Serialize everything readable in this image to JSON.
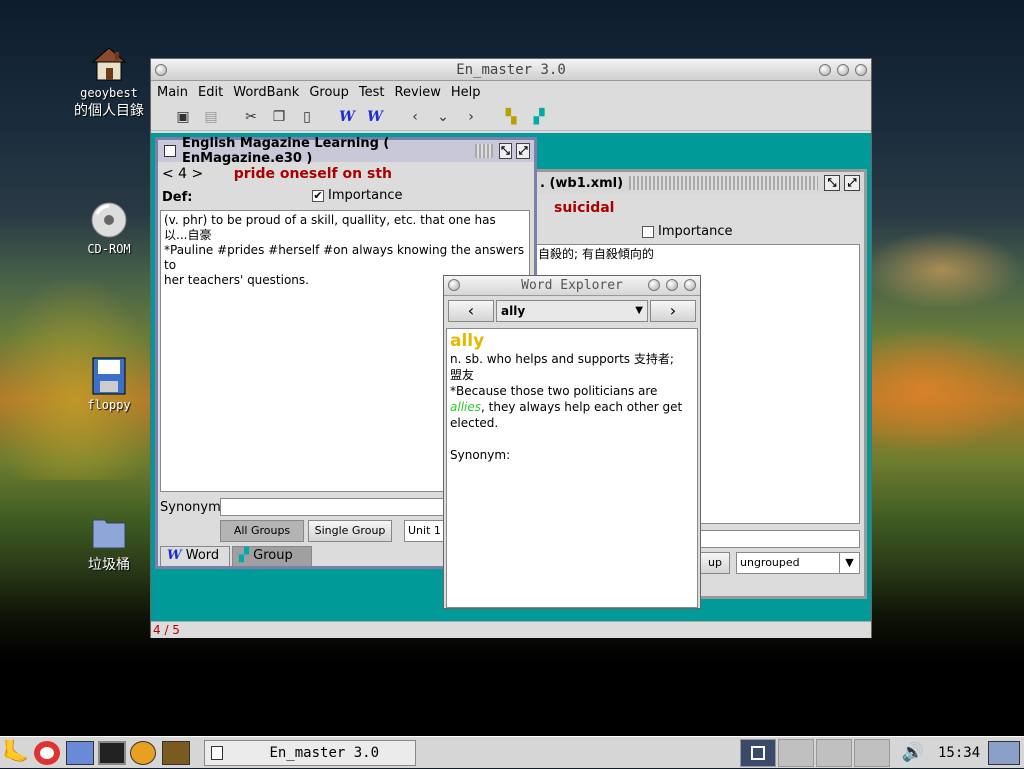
{
  "desktop": {
    "icons": [
      {
        "label_line1": "geoybest",
        "label_line2": "的個人目錄",
        "name": "home-icon"
      },
      {
        "label_line1": "CD-ROM",
        "name": "cdrom-icon"
      },
      {
        "label_line1": "floppy",
        "name": "floppy-icon"
      },
      {
        "label_line1": "垃圾桶",
        "name": "trash-icon"
      }
    ]
  },
  "app": {
    "title": "En_master 3.0",
    "menu": [
      "Main",
      "Edit",
      "WordBank",
      "Group",
      "Test",
      "Review",
      "Help"
    ],
    "status": "4 / 5"
  },
  "frame1": {
    "title": "English Magazine Learning ( EnMagazine.e30 )",
    "nav_prefix": "< 4 >",
    "headword": "pride oneself on sth",
    "def_label": "Def:",
    "importance_label": "Importance",
    "importance_checked": "✔",
    "definition_line1": "(v. phr) to be proud of a skill, quallity, etc. that one has",
    "definition_line2": "以...自豪",
    "definition_line3": "*Pauline #prides #herself #on always knowing the answers to",
    "definition_line4": "her teachers' questions.",
    "synonym_label": "Synonym:",
    "buttons": {
      "all_groups": "All Groups",
      "single_group": "Single Group"
    },
    "unit_value": "Unit 1",
    "tabs": {
      "word": "Word",
      "group": "Group"
    }
  },
  "frame2": {
    "title": ". (wb1.xml)",
    "headword": "suicidal",
    "importance_label": "Importance",
    "definition": "自殺的; 有自殺傾向的",
    "group_button": "up",
    "group_select": "ungrouped"
  },
  "word_explorer": {
    "title": "Word Explorer",
    "selected_word": "ally",
    "headword": "ally",
    "definition": "n. sb. who helps and supports 支持者;",
    "definition2": "盟友",
    "example_prefix": "*Because those two politicians are",
    "example_highlight": "allies",
    "example_suffix": ", they always help each other get",
    "example_end": "elected.",
    "synonym_label": "Synonym:"
  },
  "taskbar": {
    "task_label": "En_master 3.0",
    "clock": "15:34"
  },
  "colors": {
    "accent_teal": "#009a98",
    "headword_red": "#aa0000",
    "explorer_headword": "#e8b800",
    "highlight_green": "#2ecc2e"
  }
}
